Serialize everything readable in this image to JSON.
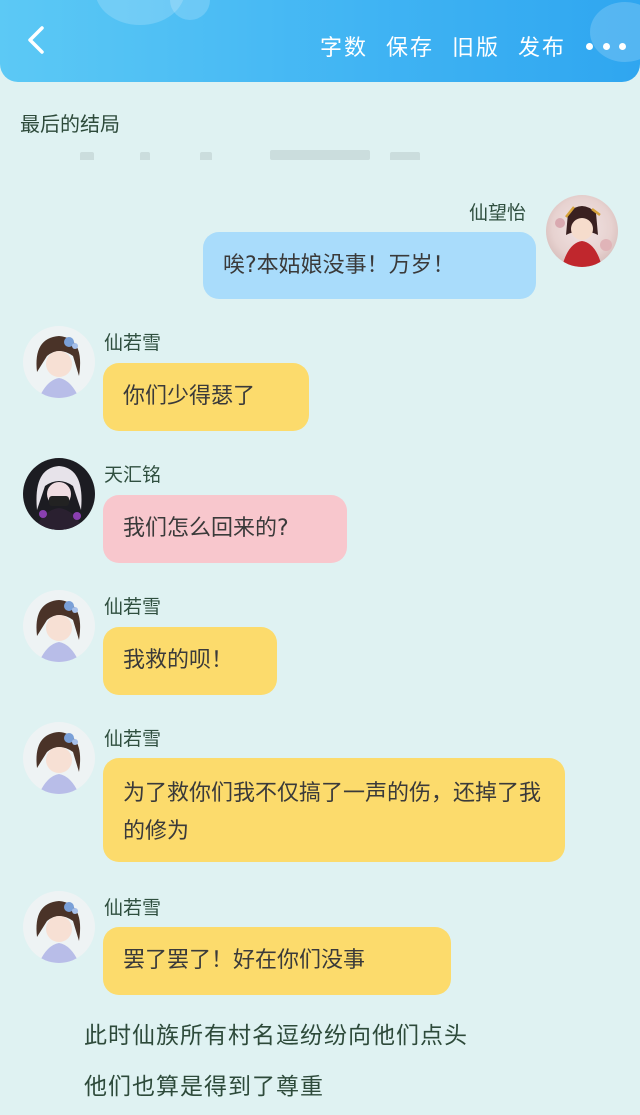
{
  "header": {
    "actions": [
      "字数",
      "保存",
      "旧版",
      "发布"
    ],
    "back_icon": "chevron-left-icon",
    "more_icon": "more-dots-icon",
    "accent": "#3fb3f3"
  },
  "chapter": {
    "title": "最后的结局"
  },
  "messages": [
    {
      "name": "仙望怡",
      "text": "唉?本姑娘没事！万岁！",
      "bubble_color": "#a9dcfb"
    },
    {
      "name": "仙若雪",
      "text": "你们少得瑟了",
      "bubble_color": "#fcdb6c"
    },
    {
      "name": "天汇铭",
      "text": "我们怎么回来的?",
      "bubble_color": "#f8c7cd"
    },
    {
      "name": "仙若雪",
      "text": "我救的呗！",
      "bubble_color": "#fcdb6c"
    },
    {
      "name": "仙若雪",
      "text": "为了救你们我不仅搞了一声的伤，还掉了我的修为",
      "bubble_color": "#fcdb6c"
    },
    {
      "name": "仙若雪",
      "text": "罢了罢了！好在你们没事",
      "bubble_color": "#fcdb6c"
    }
  ],
  "narration": [
    "此时仙族所有村名逗纷纷向他们点头",
    "他们也算是得到了尊重"
  ]
}
